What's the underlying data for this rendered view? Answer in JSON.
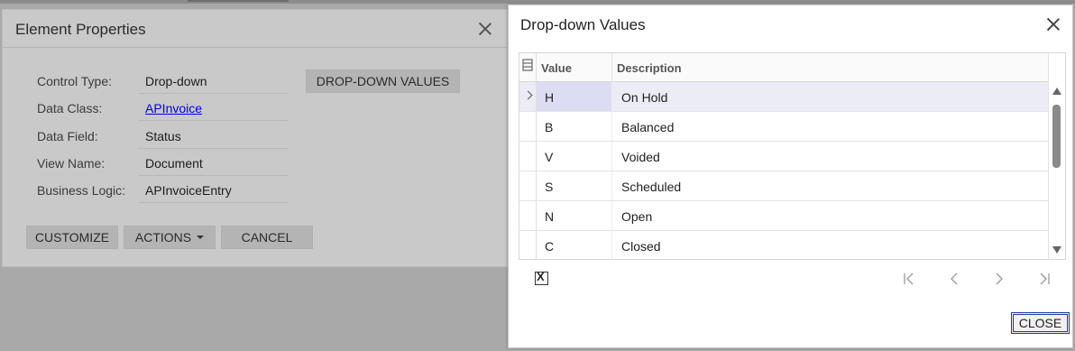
{
  "element_properties": {
    "title": "Element Properties",
    "fields": [
      {
        "label": "Control Type:",
        "value": "Drop-down"
      },
      {
        "label": "Data Class:",
        "value": "APInvoice"
      },
      {
        "label": "Data Field:",
        "value": "Status"
      },
      {
        "label": "View Name:",
        "value": "Document"
      },
      {
        "label": "Business Logic:",
        "value": "APInvoiceEntry"
      }
    ],
    "dropdown_values_button": "DROP-DOWN VALUES",
    "customize_button": "CUSTOMIZE",
    "actions_button": "ACTIONS",
    "cancel_button": "CANCEL"
  },
  "dropdown_values": {
    "title": "Drop-down Values",
    "columns": {
      "value": "Value",
      "description": "Description"
    },
    "rows": [
      {
        "value": "H",
        "description": "On Hold"
      },
      {
        "value": "B",
        "description": "Balanced"
      },
      {
        "value": "V",
        "description": "Voided"
      },
      {
        "value": "S",
        "description": "Scheduled"
      },
      {
        "value": "N",
        "description": "Open"
      },
      {
        "value": "C",
        "description": "Closed"
      }
    ],
    "close_button": "CLOSE"
  },
  "icons": {
    "close": "close-icon",
    "row_selector": "chevron-right-icon",
    "column_config": "column-config-icon",
    "export_excel": "excel-export-icon",
    "pager_first": "first-page-icon",
    "pager_prev": "previous-page-icon",
    "pager_next": "next-page-icon",
    "pager_last": "last-page-icon"
  },
  "colors": {
    "link": "#0000ee",
    "active_row": "#ececf6",
    "close_button_border": "#1f3f9f"
  }
}
